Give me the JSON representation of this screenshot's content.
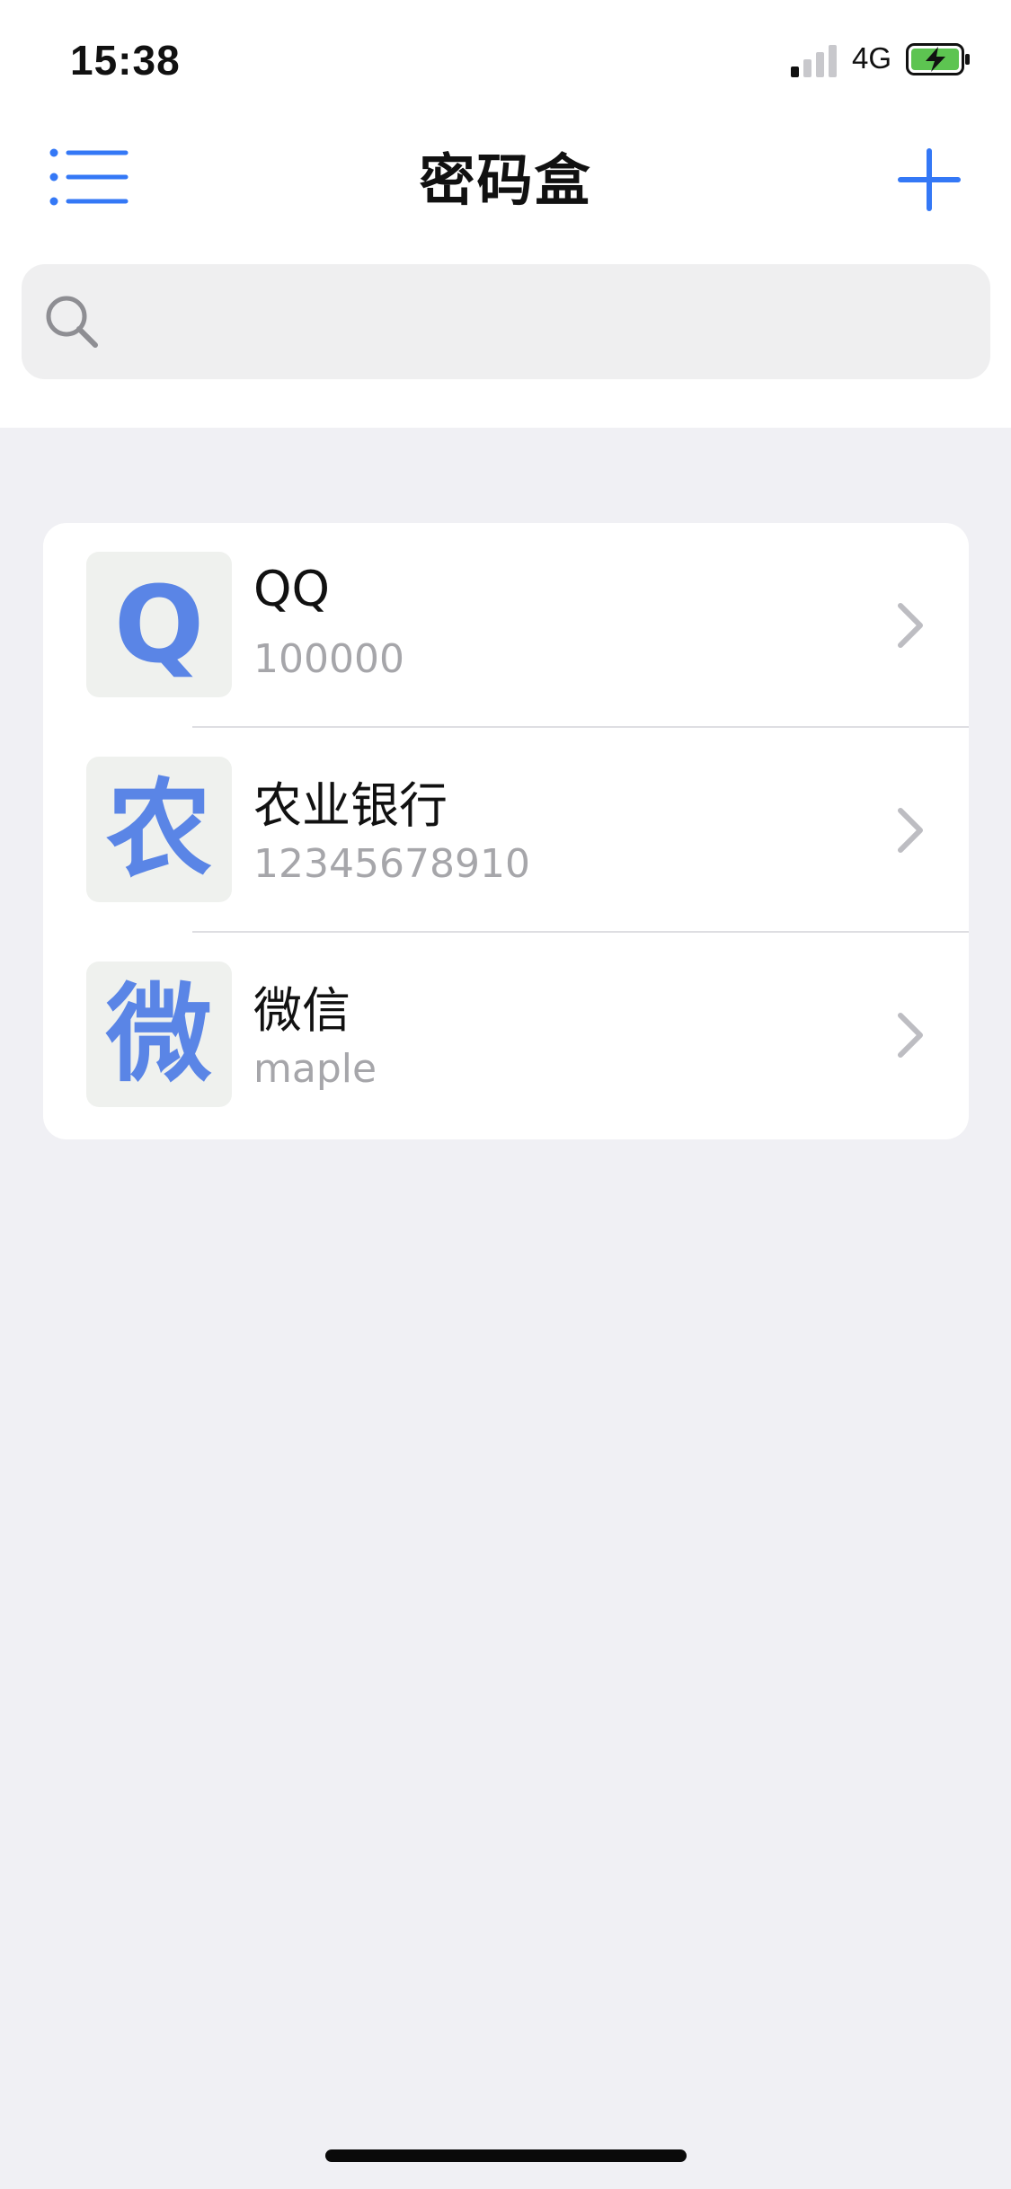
{
  "status_bar": {
    "time": "15:38",
    "network": "4G",
    "signal_bars_active": 1,
    "signal_bars_total": 4,
    "battery_icon": "battery-charging-icon"
  },
  "nav": {
    "title": "密码盒",
    "menu_icon": "list-icon",
    "add_icon": "plus-icon"
  },
  "search": {
    "icon": "search-icon",
    "placeholder": "",
    "value": ""
  },
  "entries": [
    {
      "avatar": "Q",
      "title": "QQ",
      "subtitle": "100000"
    },
    {
      "avatar": "农",
      "title": "农业银行",
      "subtitle": "12345678910"
    },
    {
      "avatar": "微",
      "title": "微信",
      "subtitle": "maple"
    }
  ],
  "colors": {
    "accent": "#3478F6",
    "avatar_text": "#5A85E6",
    "avatar_bg": "#EFF1EE",
    "background": "#F0F0F4",
    "secondary_text": "#A6A6AA",
    "battery_green": "#5DC451"
  }
}
